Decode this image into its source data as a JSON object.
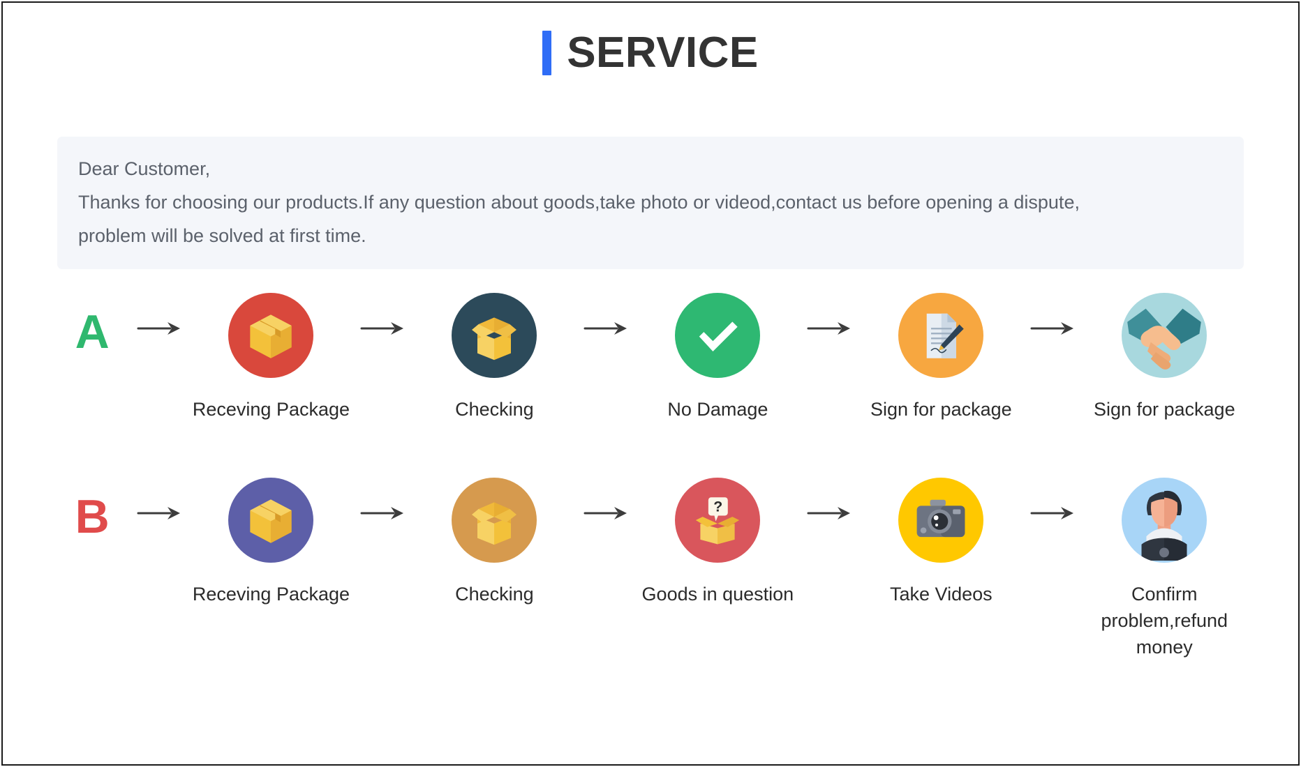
{
  "header": {
    "title": "SERVICE",
    "accent_color": "#2f6df6",
    "title_color": "#333333"
  },
  "notice": {
    "background": "#f4f6fa",
    "text_color": "#5b616b",
    "lines": [
      "Dear Customer,",
      "Thanks for choosing our products.If any question about goods,take photo or videod,contact us before opening a dispute,",
      "problem will be solved at first time."
    ]
  },
  "flows": [
    {
      "id": "flow-a",
      "letter": "A",
      "letter_color": "#2fb86e",
      "steps": [
        {
          "label": "Receving Package",
          "icon": "closed-package-icon",
          "circle_color": "#d9483c"
        },
        {
          "label": "Checking",
          "icon": "open-package-icon",
          "circle_color": "#2c4a5a"
        },
        {
          "label": "No Damage",
          "icon": "check-mark-icon",
          "circle_color": "#2eb872"
        },
        {
          "label": "Sign for package",
          "icon": "document-pen-icon",
          "circle_color": "#f7a740"
        },
        {
          "label": "Sign for package",
          "icon": "handshake-icon",
          "circle_color": "#a8d8de"
        }
      ]
    },
    {
      "id": "flow-b",
      "letter": "B",
      "letter_color": "#e04b4b",
      "steps": [
        {
          "label": "Receving Package",
          "icon": "closed-package-icon",
          "circle_color": "#5d5fa8"
        },
        {
          "label": "Checking",
          "icon": "open-package-icon",
          "circle_color": "#d69a4e"
        },
        {
          "label": "Goods in question",
          "icon": "question-box-icon",
          "circle_color": "#d9565c"
        },
        {
          "label": "Take Videos",
          "icon": "camera-icon",
          "circle_color": "#ffc800"
        },
        {
          "label": "Confirm problem,refund money",
          "icon": "support-person-icon",
          "circle_color": "#a8d5f7"
        }
      ]
    }
  ],
  "arrow": {
    "color": "#3c3c3c",
    "glyph": "right-arrow-icon"
  }
}
